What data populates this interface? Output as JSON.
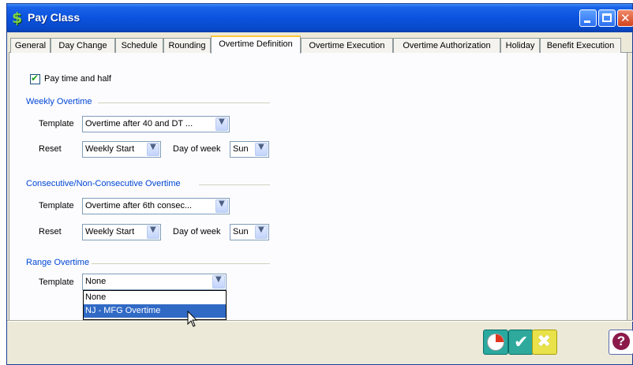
{
  "window": {
    "title": "Pay Class",
    "app_icon": "$",
    "icons": {
      "app": "dollar-icon",
      "minimize": "minimize-icon",
      "maximize": "maximize-icon",
      "close": "close-icon"
    }
  },
  "tabs": [
    {
      "label": "General",
      "active": false
    },
    {
      "label": "Day Change",
      "active": false
    },
    {
      "label": "Schedule",
      "active": false
    },
    {
      "label": "Rounding",
      "active": false
    },
    {
      "label": "Overtime Definition",
      "active": true
    },
    {
      "label": "Overtime Execution",
      "active": false
    },
    {
      "label": "Overtime Authorization",
      "active": false
    },
    {
      "label": "Holiday",
      "active": false
    },
    {
      "label": "Benefit Execution",
      "active": false
    }
  ],
  "pay_time_and_half": {
    "label": "Pay time and half",
    "checked": true
  },
  "weekly": {
    "title": "Weekly Overtime",
    "template_label": "Template",
    "template_value": "Overtime after 40 and DT ...",
    "reset_label": "Reset",
    "reset_value": "Weekly Start",
    "dow_label": "Day of week",
    "dow_value": "Sun"
  },
  "consecutive": {
    "title": "Consecutive/Non-Consecutive Overtime",
    "template_label": "Template",
    "template_value": "Overtime after 6th consec...",
    "reset_label": "Reset",
    "reset_value": "Weekly Start",
    "dow_label": "Day of week",
    "dow_value": "Sun"
  },
  "range": {
    "title": "Range Overtime",
    "template_label": "Template",
    "template_value": "None",
    "options": [
      "None",
      "NJ - MFG Overtime"
    ],
    "highlighted_option": "NJ - MFG Overtime"
  },
  "footer": {
    "icons": {
      "clock": "clock-icon",
      "ok": "checkmark-icon",
      "cancel": "cancel-x-icon",
      "help": "help-icon"
    }
  },
  "colors": {
    "titlebar": "#0a52de",
    "group_title": "#0046d5",
    "selection": "#316ac5",
    "active_tab_highlight": "#ffc83c"
  }
}
